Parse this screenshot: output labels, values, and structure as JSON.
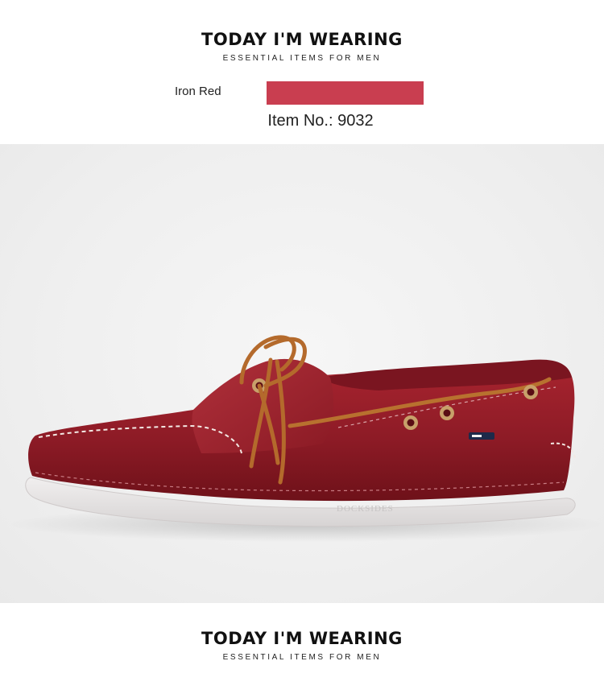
{
  "header_top": {
    "title": "TODAY I'M WEARING",
    "subtitle": "ESSENTIAL ITEMS FOR MEN"
  },
  "color_option": {
    "name": "Iron Red",
    "swatch_color": "#c93e50"
  },
  "item": {
    "number_label": "Item No.: 9032"
  },
  "product_photo": {
    "sole_logo_text": "DOCKSIDES"
  },
  "header_bottom": {
    "title": "TODAY I'M WEARING",
    "subtitle": "ESSENTIAL ITEMS FOR MEN"
  }
}
